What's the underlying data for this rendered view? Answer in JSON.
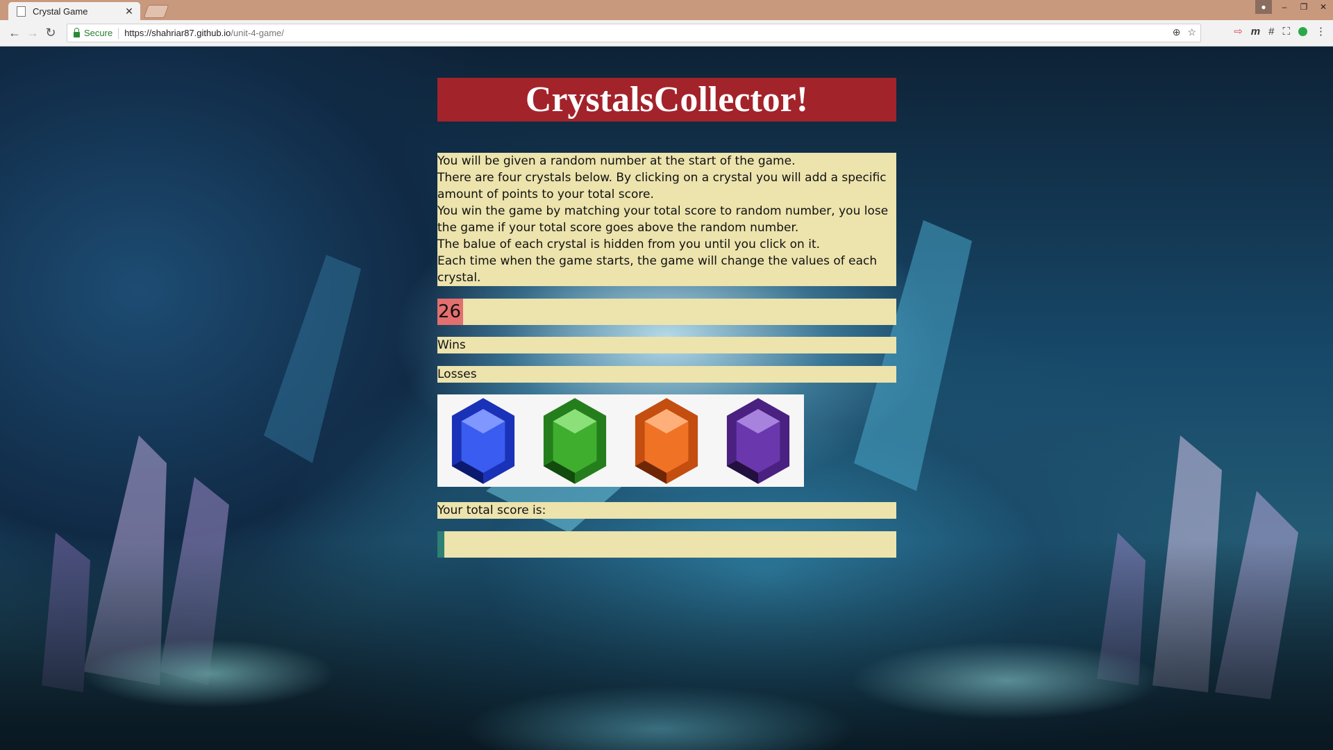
{
  "browser": {
    "tab_title": "Crystal Game",
    "secure_label": "Secure",
    "url_host": "https://shahriar87.github.io",
    "url_path": "/unit-4-game/"
  },
  "game": {
    "title": "CrystalsCollector!",
    "instructions": [
      "You will be given a random number at the start of the game.",
      "There are four crystals below. By clicking on a crystal you will add a specific amount of points to your total score.",
      "You win the game by matching your total score to random number, you lose the game if your total score goes above the random number.",
      "The balue of each crystal is hidden from you until you click on it.",
      "Each time when the game starts, the game will change the values of each crystal."
    ],
    "target_number": "26",
    "wins_label": "Wins",
    "losses_label": "Losses",
    "crystals": [
      {
        "name": "blue",
        "color": "#1f3fd6"
      },
      {
        "name": "green",
        "color": "#2f9a24"
      },
      {
        "name": "orange",
        "color": "#e2621a"
      },
      {
        "name": "purple",
        "color": "#5b2a96"
      }
    ],
    "score_label": "Your total score is:",
    "total_score": ""
  }
}
